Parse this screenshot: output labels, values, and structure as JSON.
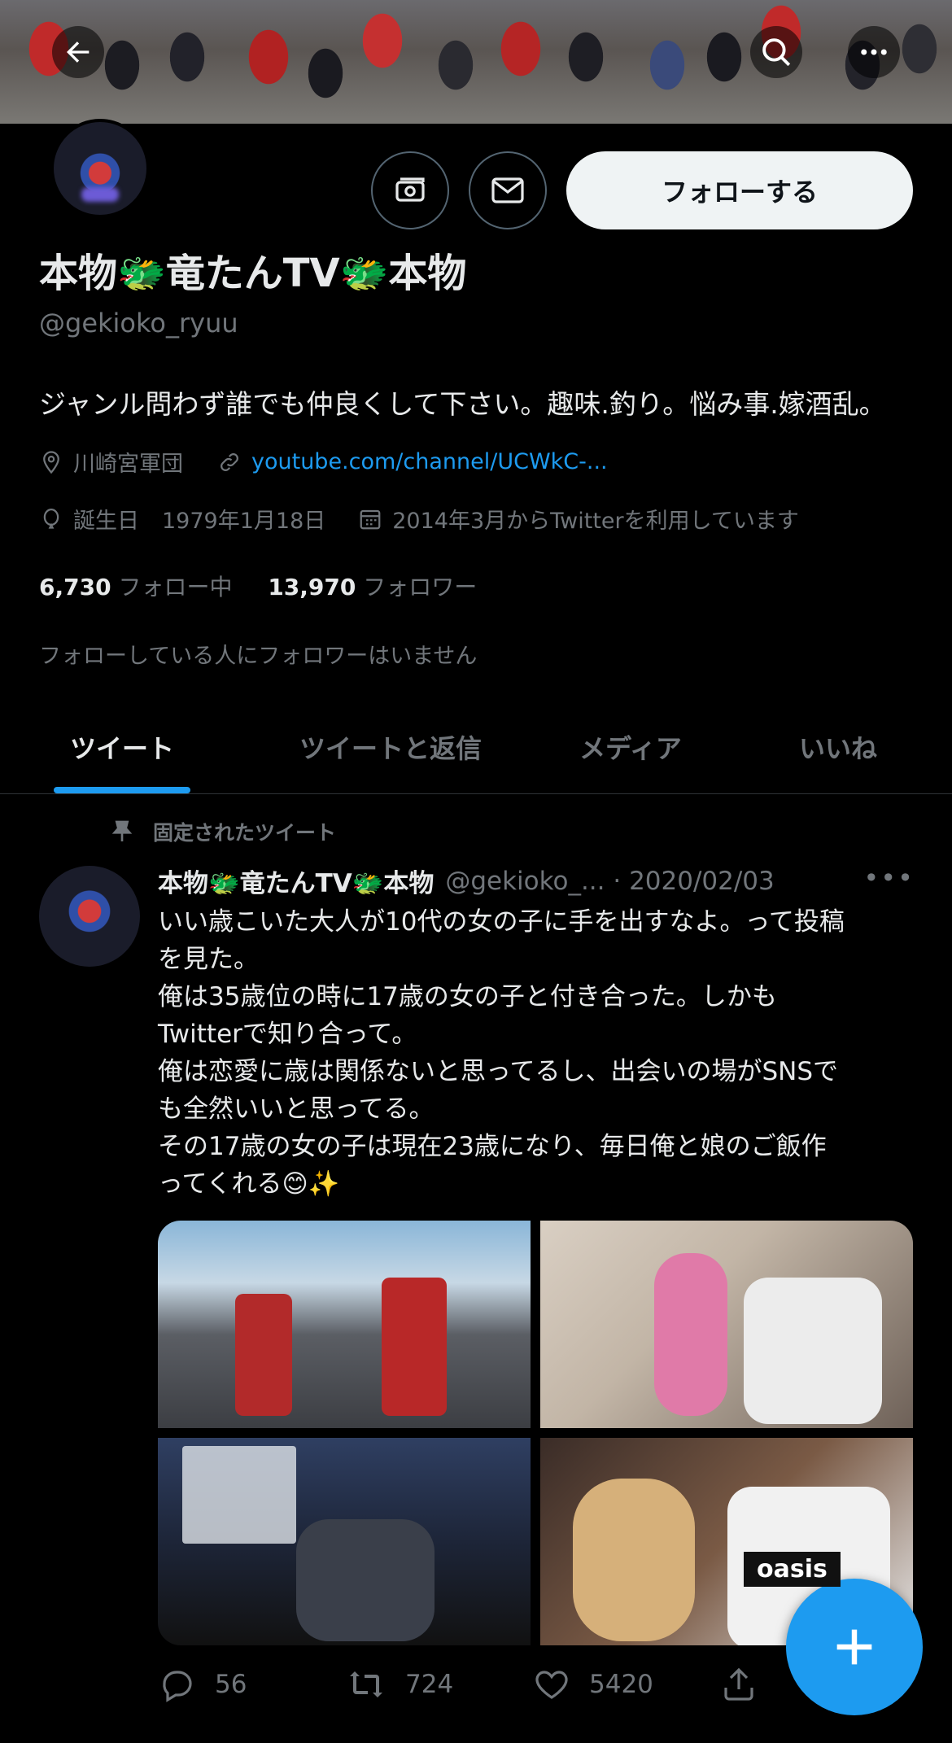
{
  "header": {
    "back_label": "戻る",
    "search_label": "検索",
    "more_label": "その他"
  },
  "profile": {
    "display_name": "本物🐲竜たんTV🐲本物",
    "handle": "@gekioko_ryuu",
    "follow_label": "フォローする",
    "bio": "ジャンル問わず誰でも仲良くして下さい。趣味.釣り。悩み事.嫁酒乱。",
    "location": "川崎宮軍団",
    "link": "youtube.com/channel/UCWkC-...",
    "birthday_label": "誕生日",
    "birthday": "1979年1月18日",
    "joined": "2014年3月からTwitterを利用しています",
    "following_count": "6,730",
    "following_label": "フォロー中",
    "followers_count": "13,970",
    "followers_label": "フォロワー",
    "followed_by_note": "フォローしている人にフォロワーはいません"
  },
  "tabs": [
    {
      "label": "ツイート",
      "active": true
    },
    {
      "label": "ツイートと返信",
      "active": false
    },
    {
      "label": "メディア",
      "active": false
    },
    {
      "label": "いいね",
      "active": false
    }
  ],
  "tweet": {
    "pinned_label": "固定されたツイート",
    "author_name": "本物🐲竜たんTV🐲本物",
    "author_meta": "@gekioko_... · 2020/02/03",
    "more": "•••",
    "lines": [
      "いい歳こいた大人が10代の女の子に手を出すなよ。って投稿",
      "を見た。",
      "俺は35歳位の時に17歳の女の子と付き合った。しかも",
      "Twitterで知り合って。",
      "俺は恋愛に歳は関係ないと思ってるし、出会いの場がSNSで",
      "も全然いいと思ってる。",
      "その17歳の女の子は現在23歳になり、毎日俺と娘のご飯作",
      "ってくれる😊✨"
    ],
    "media_text": "oasis",
    "replies": "56",
    "retweets": "724",
    "likes": "5420"
  },
  "colors": {
    "accent": "#1d9bf0",
    "background": "#000000",
    "secondary_text": "#71767b"
  }
}
